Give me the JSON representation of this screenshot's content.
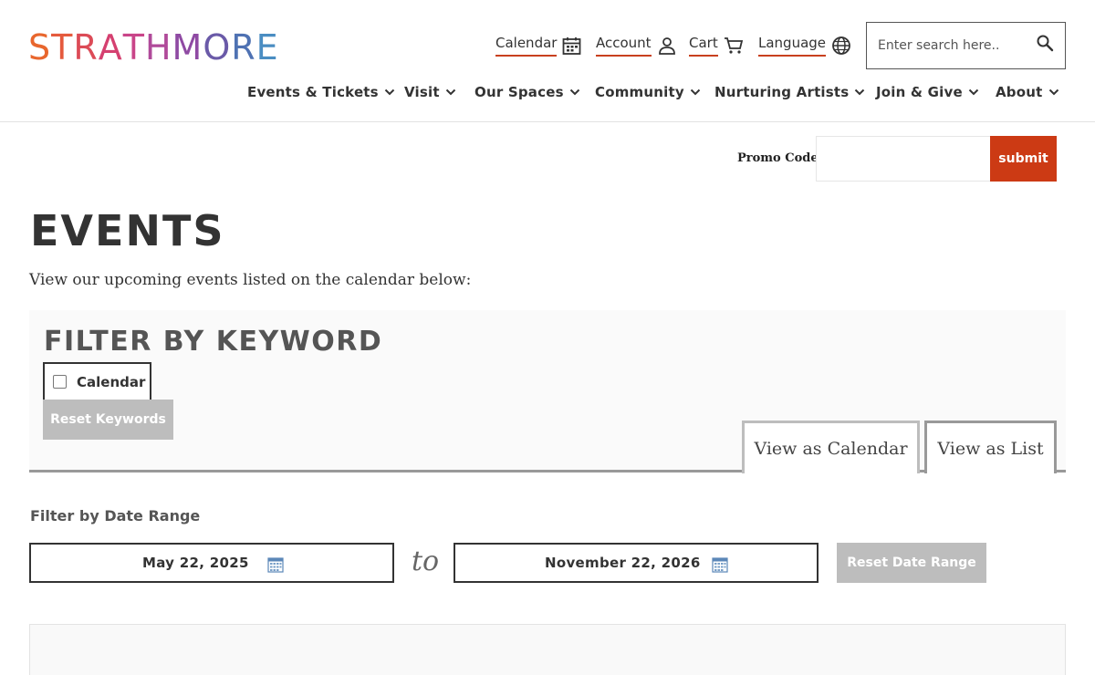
{
  "header": {
    "logo_text": "STRATHMORE",
    "logo_colors": [
      "#e8662d",
      "#e55a3d",
      "#dc4b57",
      "#d54070",
      "#c94589",
      "#b04a9a",
      "#8f4aa3",
      "#6a5aa8",
      "#4f72b3",
      "#4a8dc2"
    ],
    "utility": [
      {
        "label": "Calendar",
        "icon": "calendar-icon"
      },
      {
        "label": "Account",
        "icon": "user-icon"
      },
      {
        "label": "Cart",
        "icon": "cart-icon"
      },
      {
        "label": "Language",
        "icon": "globe-icon"
      }
    ],
    "search": {
      "placeholder": "Enter search here..",
      "icon": "search-icon"
    },
    "nav": [
      "Events & Tickets",
      "Visit",
      "Our Spaces",
      "Community",
      "Nurturing Artists",
      "Join & Give",
      "About"
    ]
  },
  "promo": {
    "label": "Promo Code",
    "submit_label": "submit",
    "accent": "#cc3a14"
  },
  "main": {
    "title": "EVENTS",
    "intro": "View our upcoming events listed on the calendar below:"
  },
  "filter": {
    "title": "FILTER BY KEYWORD",
    "keywords": [
      {
        "label": "Calendar",
        "checked": false
      }
    ],
    "reset_label": "Reset Keywords",
    "tabs": [
      "View as Calendar",
      "View as List"
    ],
    "active_tab": "View as List"
  },
  "date_range": {
    "label": "Filter by Date Range",
    "start": "May 22, 2025",
    "separator": "to",
    "end": "November 22, 2026",
    "reset_label": "Reset Date Range"
  }
}
